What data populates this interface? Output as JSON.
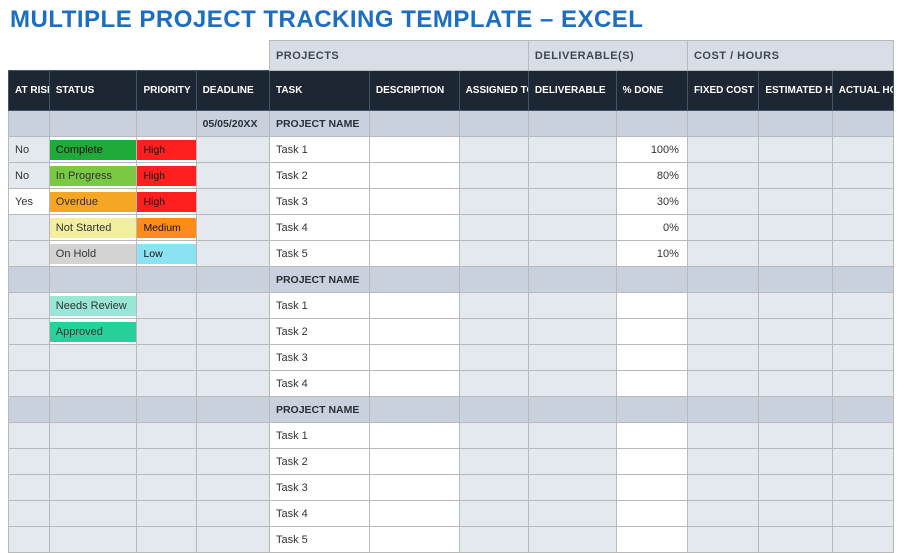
{
  "title": "MULTIPLE PROJECT TRACKING TEMPLATE – EXCEL",
  "sections": {
    "projects": "PROJECTS",
    "deliverables": "DELIVERABLE(S)",
    "cost": "COST / HOURS"
  },
  "headers": {
    "at_risk": "AT RISK",
    "status": "STATUS",
    "priority": "PRIORITY",
    "deadline": "DEADLINE",
    "task": "TASK",
    "description": "DESCRIPTION",
    "assigned_to": "ASSIGNED TO",
    "deliverable": "DELIVERABLE",
    "pct_done": "% DONE",
    "fixed_cost": "FIXED COST",
    "est_hours": "ESTIMATED HOURS",
    "actual_hours": "ACTUAL HOURS"
  },
  "group_deadline": "05/05/20XX",
  "group_label": "PROJECT NAME",
  "labels": {
    "no": "No",
    "yes": "Yes",
    "status_complete": "Complete",
    "status_inprogress": "In Progress",
    "status_overdue": "Overdue",
    "status_notstarted": "Not Started",
    "status_onhold": "On Hold",
    "status_needsreview": "Needs Review",
    "status_approved": "Approved",
    "prio_high": "High",
    "prio_medium": "Medium",
    "prio_low": "Low"
  },
  "tasks1": [
    {
      "at_risk": "No",
      "status": "Complete",
      "priority": "High",
      "task": "Task 1",
      "pct": "100%"
    },
    {
      "at_risk": "No",
      "status": "In Progress",
      "priority": "High",
      "task": "Task 2",
      "pct": "80%"
    },
    {
      "at_risk": "Yes",
      "status": "Overdue",
      "priority": "High",
      "task": "Task 3",
      "pct": "30%"
    },
    {
      "at_risk": "",
      "status": "Not Started",
      "priority": "Medium",
      "task": "Task 4",
      "pct": "0%"
    },
    {
      "at_risk": "",
      "status": "On Hold",
      "priority": "Low",
      "task": "Task 5",
      "pct": "10%"
    }
  ],
  "tasks2": [
    {
      "status": "Needs Review",
      "task": "Task 1"
    },
    {
      "status": "Approved",
      "task": "Task 2"
    },
    {
      "status": "",
      "task": "Task 3"
    },
    {
      "status": "",
      "task": "Task 4"
    }
  ],
  "tasks3": [
    {
      "task": "Task 1"
    },
    {
      "task": "Task 2"
    },
    {
      "task": "Task 3"
    },
    {
      "task": "Task 4"
    },
    {
      "task": "Task 5"
    }
  ]
}
